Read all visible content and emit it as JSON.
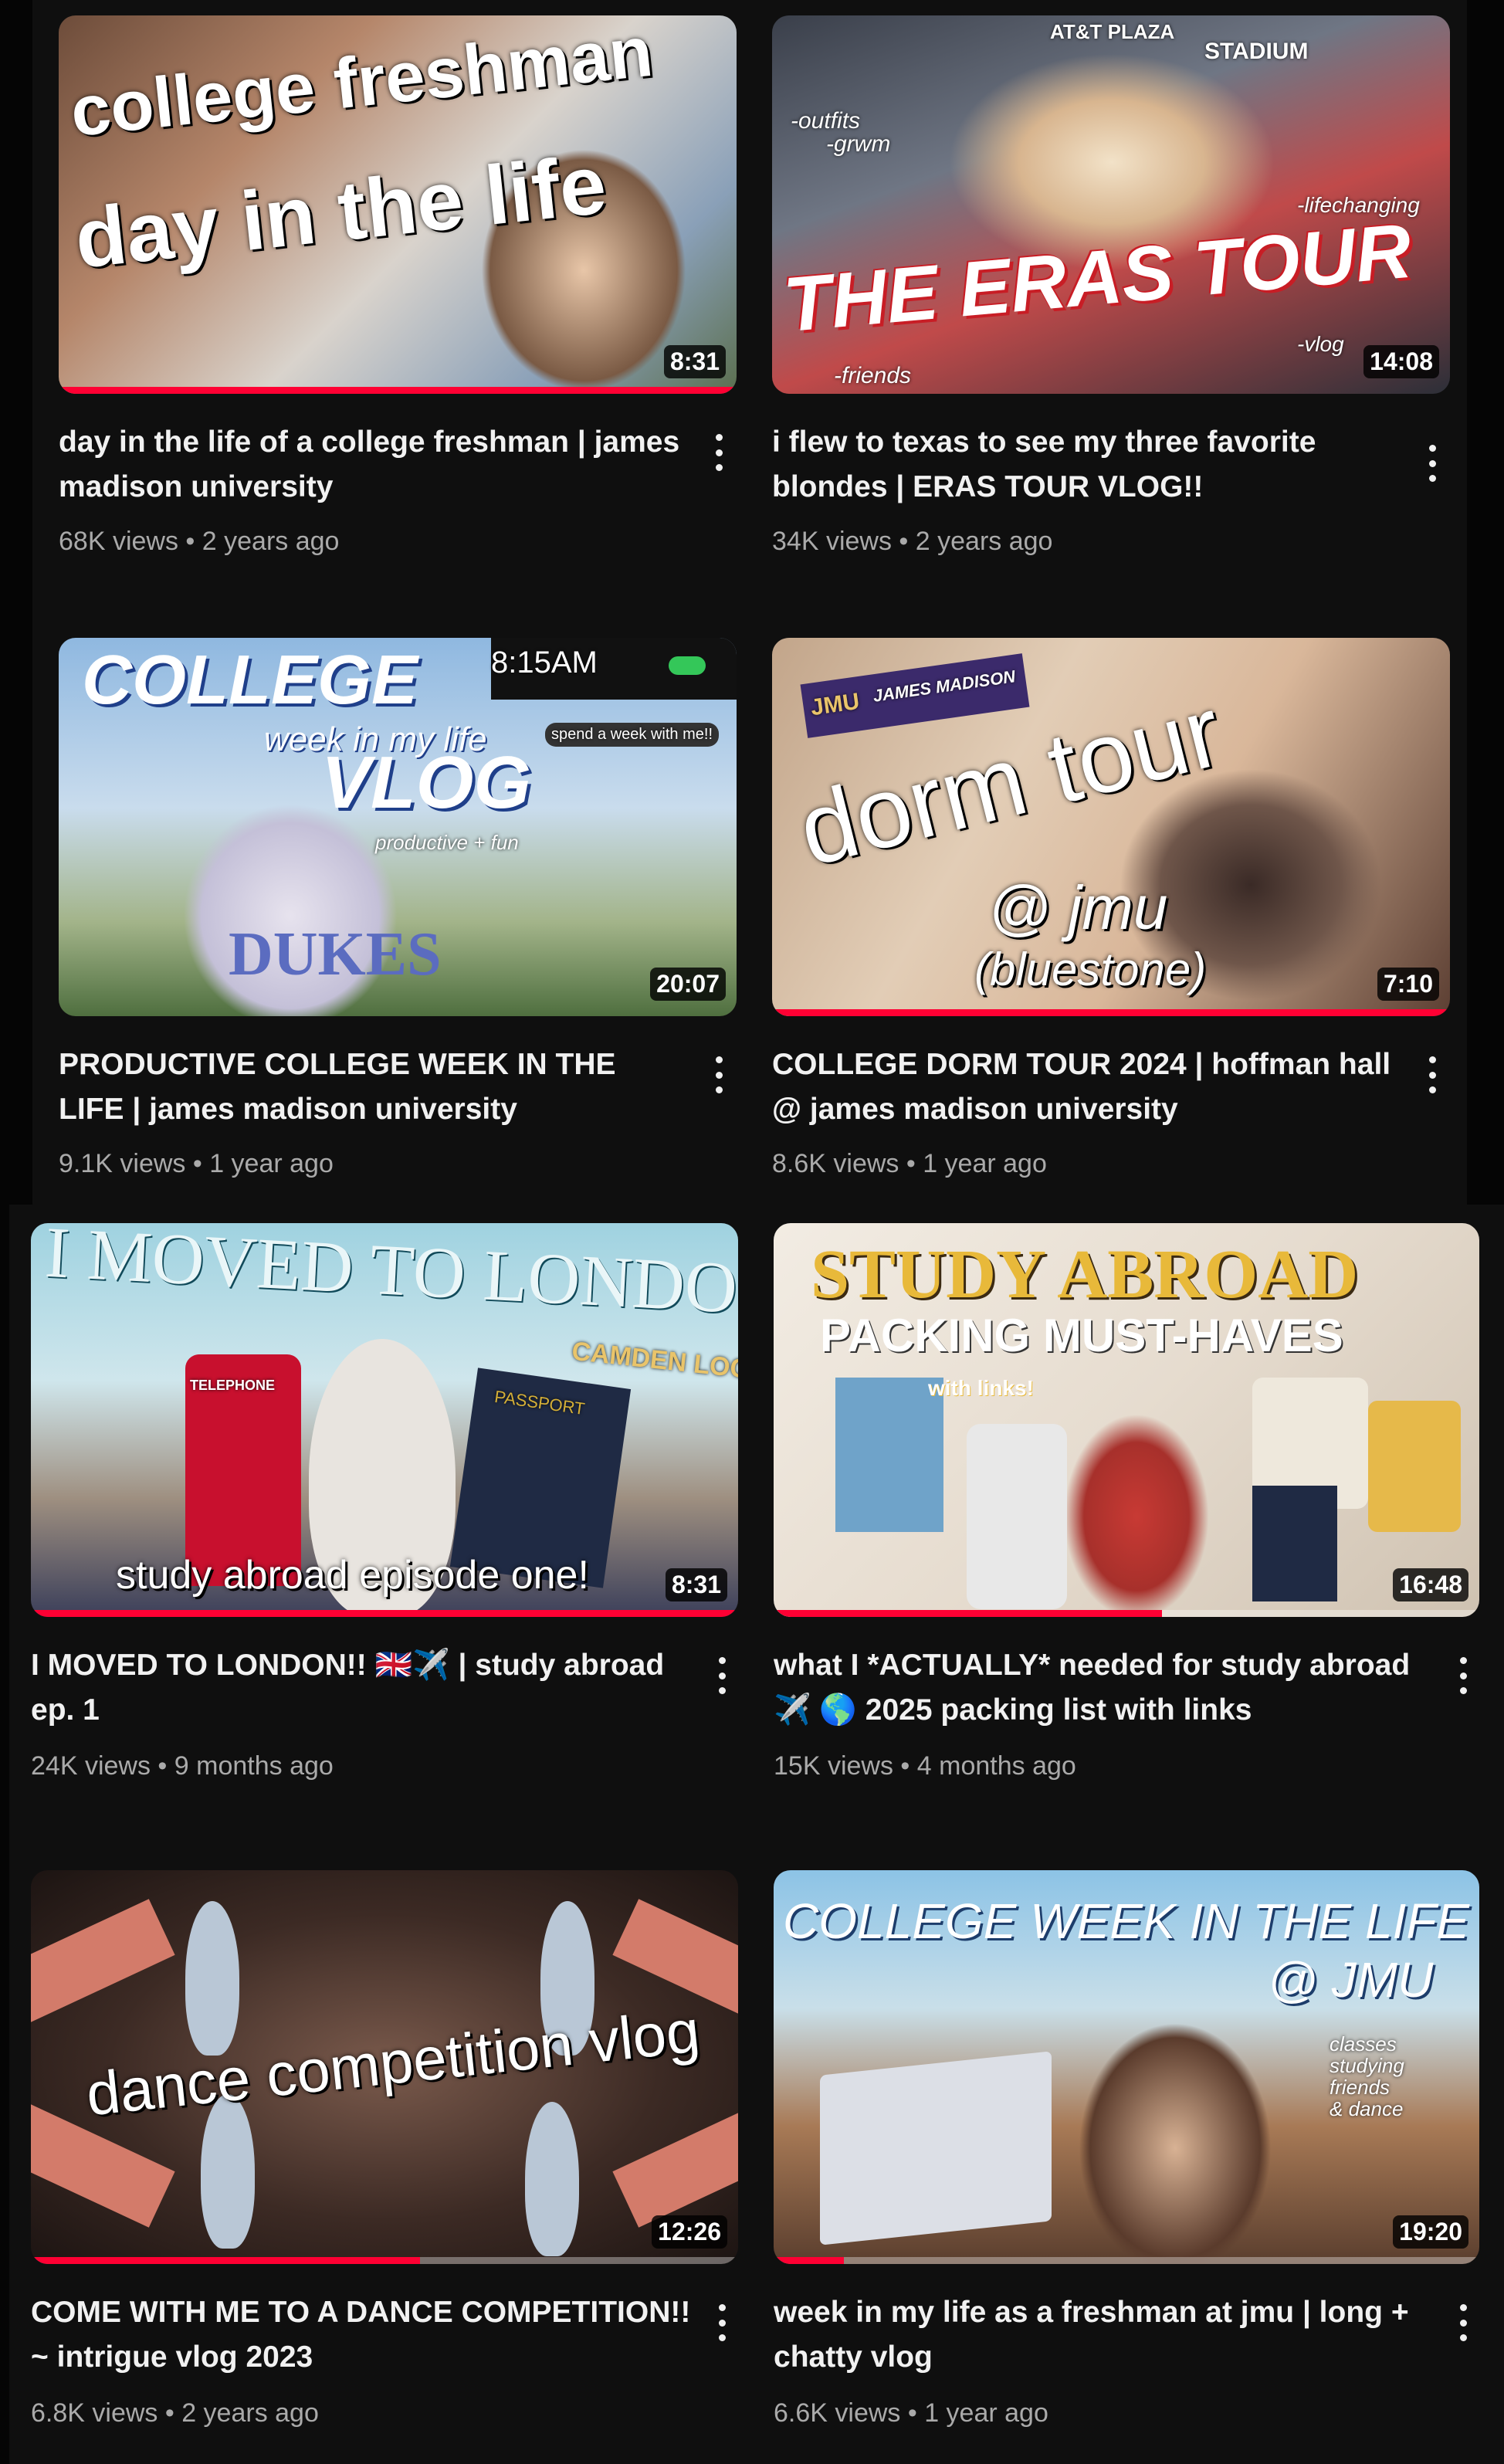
{
  "colors": {
    "background": "#0f0f0f",
    "progress": "#ff0033",
    "title_text": "#f1f1f1",
    "meta_text": "#aaaaaa"
  },
  "videos": [
    {
      "title": "day in the life of a college freshman | james madison university",
      "views": "68K views",
      "age": "2 years ago",
      "duration": "8:31",
      "progress": 1.0,
      "thumb_text": [
        "college freshman",
        "day in the life"
      ],
      "thumb_small": [],
      "menu_icon": "more-vertical-icon"
    },
    {
      "title": "i flew to texas to see my three favorite blondes | ERAS TOUR VLOG!!",
      "views": "34K views",
      "age": "2 years ago",
      "duration": "14:08",
      "progress": 0.0,
      "thumb_text": [
        "THE ERAS TOUR"
      ],
      "thumb_small": [
        "-outfits",
        "-grwm",
        "-lifechanging",
        "-vlog",
        "-friends",
        "AT&T PLAZA",
        "STADIUM"
      ],
      "menu_icon": "more-vertical-icon"
    },
    {
      "title": "PRODUCTIVE COLLEGE WEEK IN THE LIFE | james madison university",
      "views": "9.1K views",
      "age": "1 year ago",
      "duration": "20:07",
      "progress": 0.0,
      "thumb_text": [
        "COLLEGE",
        "week in my life",
        "VLOG"
      ],
      "thumb_small": [
        "8:15AM",
        "spend a week with me!!",
        "productive + fun",
        "DUKES"
      ],
      "menu_icon": "more-vertical-icon"
    },
    {
      "title": "COLLEGE DORM TOUR 2024 | hoffman hall @ james madison university",
      "views": "8.6K views",
      "age": "1 year ago",
      "duration": "7:10",
      "progress": 1.0,
      "thumb_text": [
        "dorm tour",
        "@ jmu",
        "(bluestone)"
      ],
      "thumb_small": [
        "JMU",
        "JAMES MADISON"
      ],
      "menu_icon": "more-vertical-icon"
    },
    {
      "title": "I MOVED TO LONDON!! 🇬🇧✈️ | study abroad ep. 1",
      "views": "24K views",
      "age": "9 months ago",
      "duration": "8:31",
      "progress": 1.0,
      "thumb_text": [
        "I MOVED TO LONDON",
        "study abroad episode one!"
      ],
      "thumb_small": [
        "TELEPHONE",
        "PASSPORT",
        "CAMDEN LOCK"
      ],
      "menu_icon": "more-vertical-icon"
    },
    {
      "title": "what I *ACTUALLY* needed for study abroad ✈️ 🌎 2025 packing list with links",
      "views": "15K views",
      "age": "4 months ago",
      "duration": "16:48",
      "progress": 0.55,
      "thumb_text": [
        "STUDY ABROAD",
        "PACKING MUST-HAVES"
      ],
      "thumb_small": [
        "with links!"
      ],
      "menu_icon": "more-vertical-icon"
    },
    {
      "title": "COME WITH ME TO A DANCE COMPETITION!! ~ intrigue vlog 2023",
      "views": "6.8K views",
      "age": "2 years ago",
      "duration": "12:26",
      "progress": 0.55,
      "thumb_text": [
        "dance competition vlog"
      ],
      "thumb_small": [],
      "menu_icon": "more-vertical-icon"
    },
    {
      "title": "week in my life as a freshman at jmu | long + chatty vlog",
      "views": "6.6K views",
      "age": "1 year ago",
      "duration": "19:20",
      "progress": 0.1,
      "thumb_text": [
        "COLLEGE WEEK IN THE LIFE",
        "@ JMU"
      ],
      "thumb_small": [
        "classes",
        "studying",
        "friends",
        "& dance"
      ],
      "menu_icon": "more-vertical-icon"
    }
  ]
}
